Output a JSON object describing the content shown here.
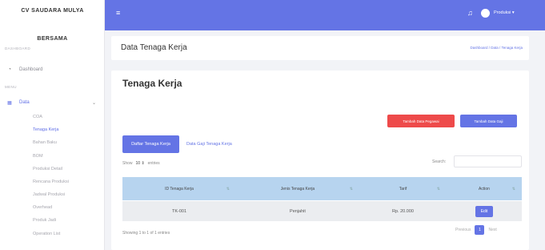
{
  "sidebar": {
    "brand_line1": "CV SAUDARA MULYA",
    "brand_line2": "BERSAMA",
    "section_dashboard": "DASHBOARD",
    "dashboard_label": "Dashboard",
    "section_menu": "MENU",
    "data_label": "Data",
    "sub_items": [
      "COA",
      "Tenaga Kerja",
      "Bahan Baku",
      "BOM",
      "Produksi Detail",
      "Rencana Produksi",
      "Jadwal Produksi",
      "Overhead",
      "Produk Jadi",
      "Operation List"
    ]
  },
  "topbar": {
    "user_label": "Produksi ▾"
  },
  "header": {
    "page_title": "Data Tenaga Kerja",
    "breadcrumb": "Dashboard / Data / Tenaga Kerja"
  },
  "main": {
    "card_title": "Tenaga Kerja",
    "btn_add_employee": "Tambah Data Pegawai",
    "btn_add_salary": "Tambah Data Gaji",
    "tab_active": "Daftar Tenaga Kerja",
    "tab_other": "Data Gaji Tenaga Kerja",
    "show_label": "Show",
    "entries_value": "10 ⇕",
    "entries_label": "entries",
    "search_label": "Search:",
    "table": {
      "headers": [
        "ID Tenaga Kerja",
        "Jenis Tenaga Kerja",
        "Tarif",
        "Action"
      ],
      "rows": [
        {
          "id": "TK-001",
          "jenis": "Penjahit",
          "tarif": "Rp. 20.000",
          "action": "Edit"
        }
      ]
    },
    "info": "Showing 1 to 1 of 1 entries",
    "pagination": {
      "previous": "Previous",
      "page": "1",
      "next": "Next"
    }
  },
  "colors": {
    "accent": "#6474e5",
    "danger": "#ee4a4a",
    "table_header": "#b7d4ef"
  }
}
